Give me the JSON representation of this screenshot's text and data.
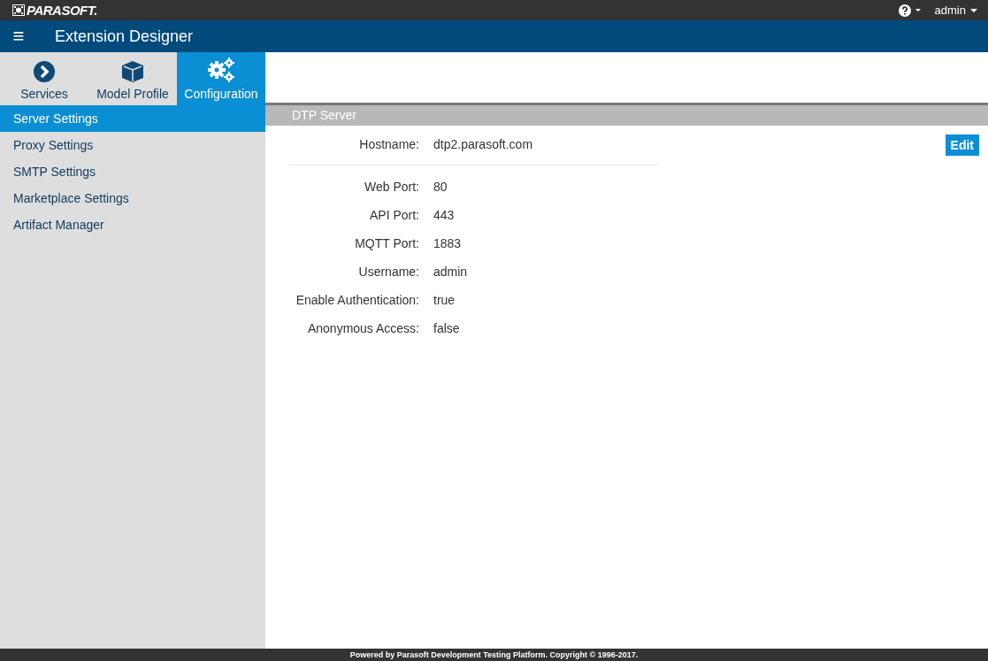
{
  "topbar": {
    "logo": "PARASOFT.",
    "user": "admin"
  },
  "header": {
    "menu_icon": "≡",
    "title": "Extension Designer"
  },
  "tabs": [
    {
      "label": "Services",
      "kind": "chevron",
      "selected": false
    },
    {
      "label": "Model Profile",
      "kind": "cube",
      "selected": false
    },
    {
      "label": "Configuration",
      "kind": "gears",
      "selected": true
    }
  ],
  "sidebar": {
    "items": [
      {
        "label": "Server Settings",
        "selected": true
      },
      {
        "label": "Proxy Settings",
        "selected": false
      },
      {
        "label": "SMTP Settings",
        "selected": false
      },
      {
        "label": "Marketplace Settings",
        "selected": false
      },
      {
        "label": "Artifact Manager",
        "selected": false
      }
    ]
  },
  "panel": {
    "title": "DTP Server",
    "edit_button": "Edit",
    "fields": [
      {
        "label": "Hostname:",
        "value": "dtp2.parasoft.com",
        "separated": true
      },
      {
        "label": "Web Port:",
        "value": "80",
        "separated": false
      },
      {
        "label": "API Port:",
        "value": "443",
        "separated": false
      },
      {
        "label": "MQTT Port:",
        "value": "1883",
        "separated": false
      },
      {
        "label": "Username:",
        "value": "admin",
        "separated": false
      },
      {
        "label": "Enable Authentication:",
        "value": "true",
        "separated": false
      },
      {
        "label": "Anonymous Access:",
        "value": "false",
        "separated": false
      }
    ]
  },
  "footer": "Powered by Parasoft Development Testing Platform. Copyright © 1996-2017."
}
